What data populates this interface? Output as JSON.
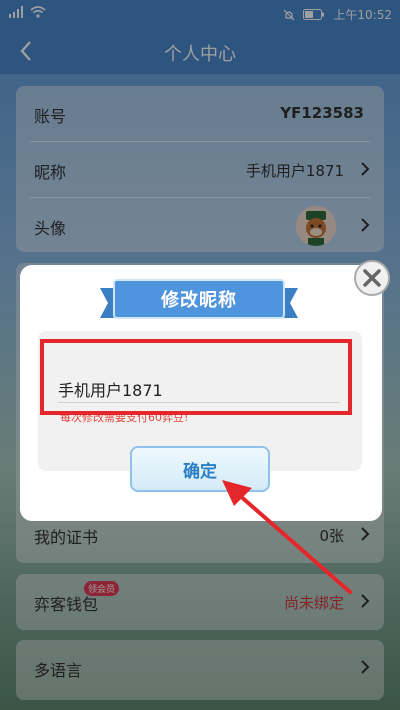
{
  "status_bar": {
    "time": "上午10:52",
    "signal_icon": "signal-icon",
    "wifi_icon": "wifi-icon",
    "battery_icon": "battery-icon"
  },
  "header": {
    "title": "个人中心",
    "back_icon": "chevron-left-icon"
  },
  "profile": {
    "account_label": "账号",
    "account_value": "YF123583",
    "nickname_label": "昵称",
    "nickname_value": "手机用户1871",
    "avatar_label": "头像"
  },
  "lower": {
    "certificate_label": "我的证书",
    "certificate_value": "0张",
    "wallet_label": "弈客钱包",
    "wallet_badge": "领会员",
    "wallet_value": "尚未绑定",
    "language_label": "多语言"
  },
  "dialog": {
    "title": "修改昵称",
    "input_value": "手机用户1871",
    "hint": "每次修改需要支付60弈豆!",
    "confirm_label": "确定"
  },
  "colors": {
    "header": "#4a89cf",
    "highlight": "#e5272b",
    "ribbon": "#4f95dd",
    "confirm_text": "#2b7fc5"
  }
}
